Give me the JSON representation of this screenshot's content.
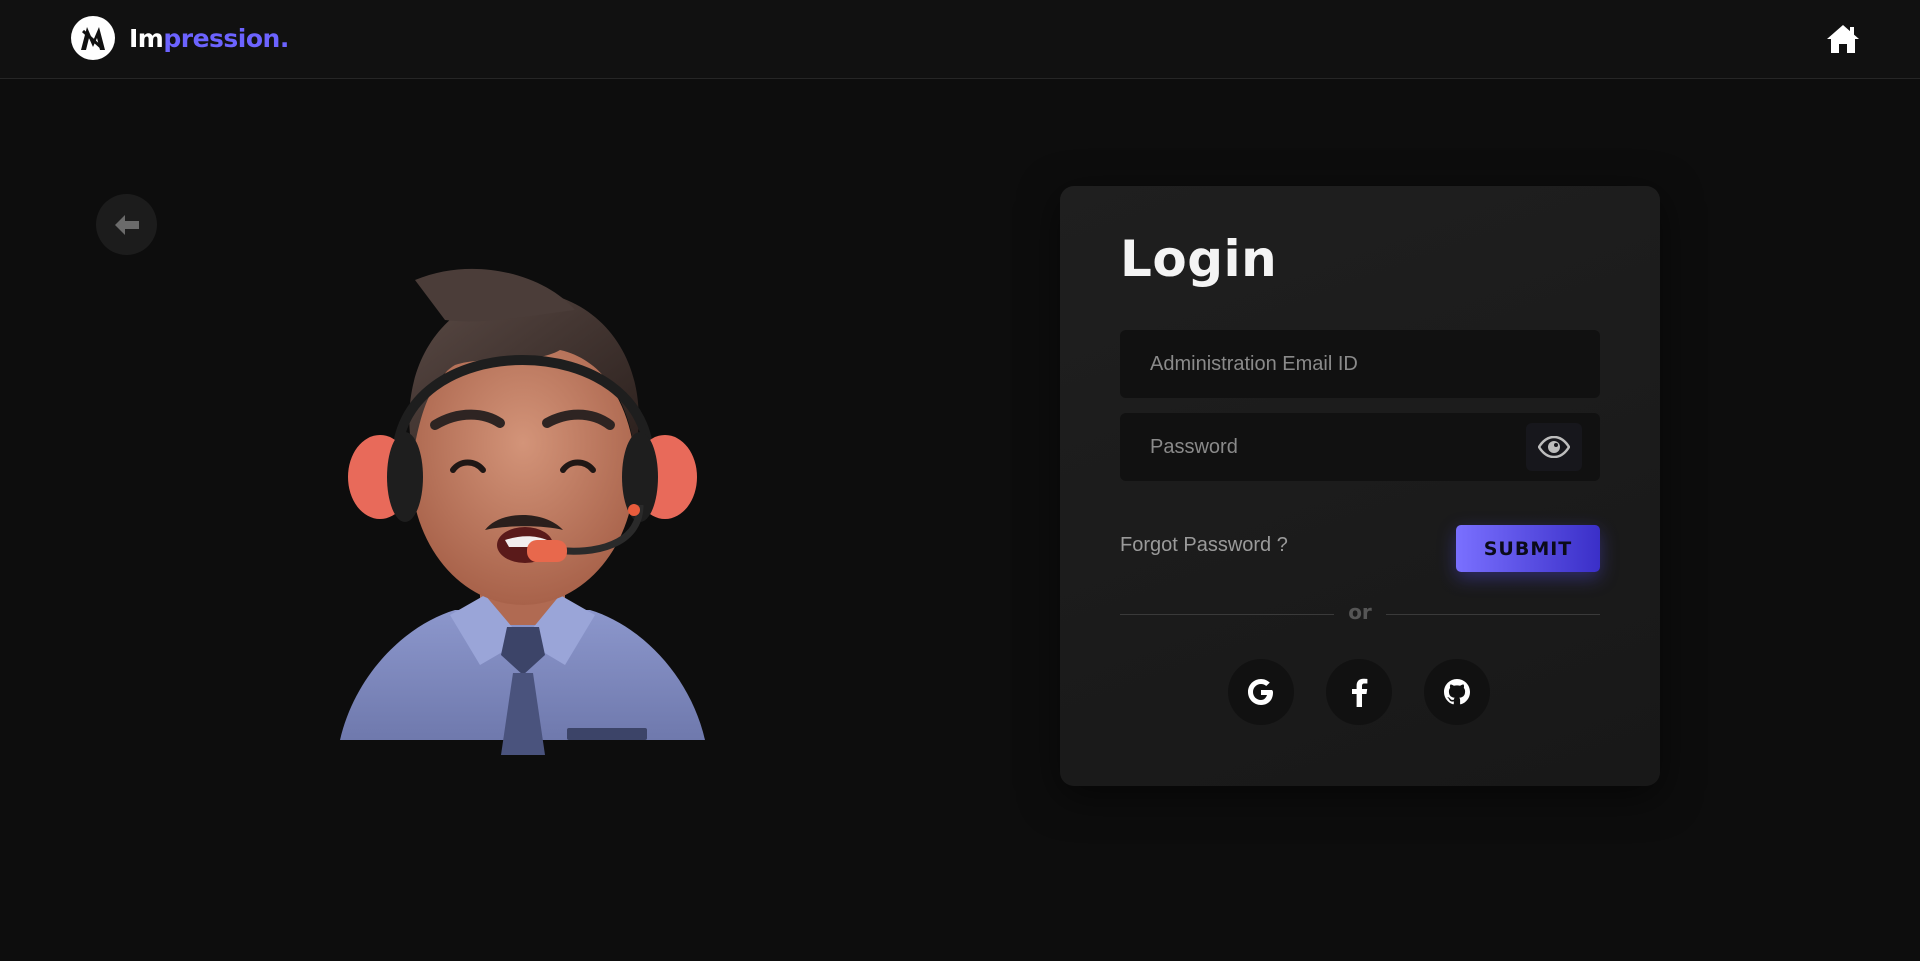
{
  "navbar": {
    "brand_prefix": "Im",
    "brand_suffix": "pression.",
    "logo_icon": "impression-logo-icon",
    "home_icon": "home-icon"
  },
  "back_icon": "arrow-left-icon",
  "illustration": "support-agent-avatar-with-headset",
  "login": {
    "title": "Login",
    "email_placeholder": "Administration Email ID",
    "email_value": "",
    "password_placeholder": "Password",
    "password_value": "",
    "toggle_visibility_icon": "eye-icon",
    "forgot_label": "Forgot Password ?",
    "submit_label": "SUBMIT",
    "divider_label": "or",
    "social": [
      {
        "icon": "google-icon"
      },
      {
        "icon": "facebook-icon"
      },
      {
        "icon": "github-icon"
      }
    ]
  },
  "colors": {
    "background": "#0d0d0d",
    "navbar": "#111111",
    "card": "#1c1c1c",
    "accent": "#6c63ff",
    "submit_gradient_start": "#7a70ff",
    "submit_gradient_end": "#3a2fc8"
  }
}
